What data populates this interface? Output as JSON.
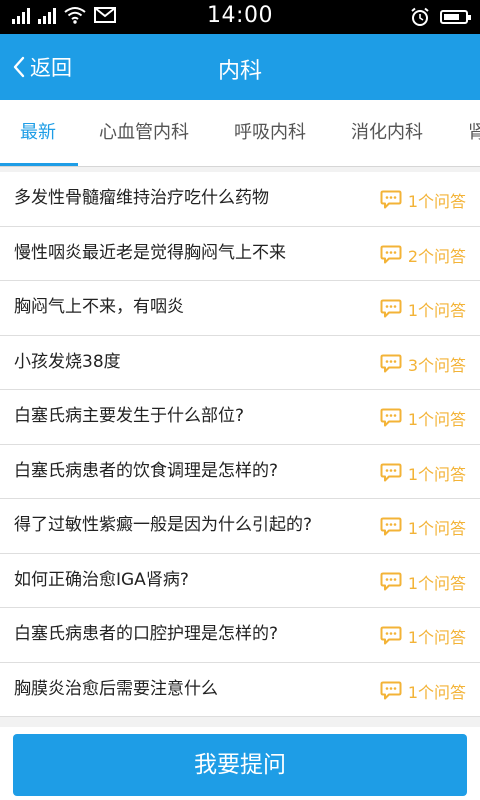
{
  "status_bar": {
    "time": "14:00",
    "icons": [
      "signal-icon",
      "signal-icon",
      "wifi-icon",
      "mail-icon",
      "alarm-icon",
      "battery-icon"
    ],
    "battery_level": 0.75
  },
  "header": {
    "back_label": "返回",
    "title": "内科",
    "accent_color": "#1e9de6"
  },
  "tabs": [
    {
      "label": "最新",
      "active": true
    },
    {
      "label": "心血管内科"
    },
    {
      "label": "呼吸内科"
    },
    {
      "label": "消化内科"
    },
    {
      "label": "肾"
    }
  ],
  "questions": [
    {
      "title": "多发性骨髓瘤维持治疗吃什么药物",
      "count": "1个问答"
    },
    {
      "title": "慢性咽炎最近老是觉得胸闷气上不来",
      "count": "2个问答"
    },
    {
      "title": "胸闷气上不来，有咽炎",
      "count": "1个问答"
    },
    {
      "title": "小孩发烧38度",
      "count": "3个问答"
    },
    {
      "title": "白塞氏病主要发生于什么部位?",
      "count": "1个问答"
    },
    {
      "title": "白塞氏病患者的饮食调理是怎样的?",
      "count": "1个问答"
    },
    {
      "title": "得了过敏性紫癜一般是因为什么引起的?",
      "count": "1个问答"
    },
    {
      "title": "如何正确治愈IGA肾病?",
      "count": "1个问答"
    },
    {
      "title": "白塞氏病患者的口腔护理是怎样的?",
      "count": "1个问答"
    },
    {
      "title": "胸膜炎治愈后需要注意什么",
      "count": "1个问答"
    }
  ],
  "count_color": "#f3b337",
  "ask_button": {
    "label": "我要提问"
  }
}
